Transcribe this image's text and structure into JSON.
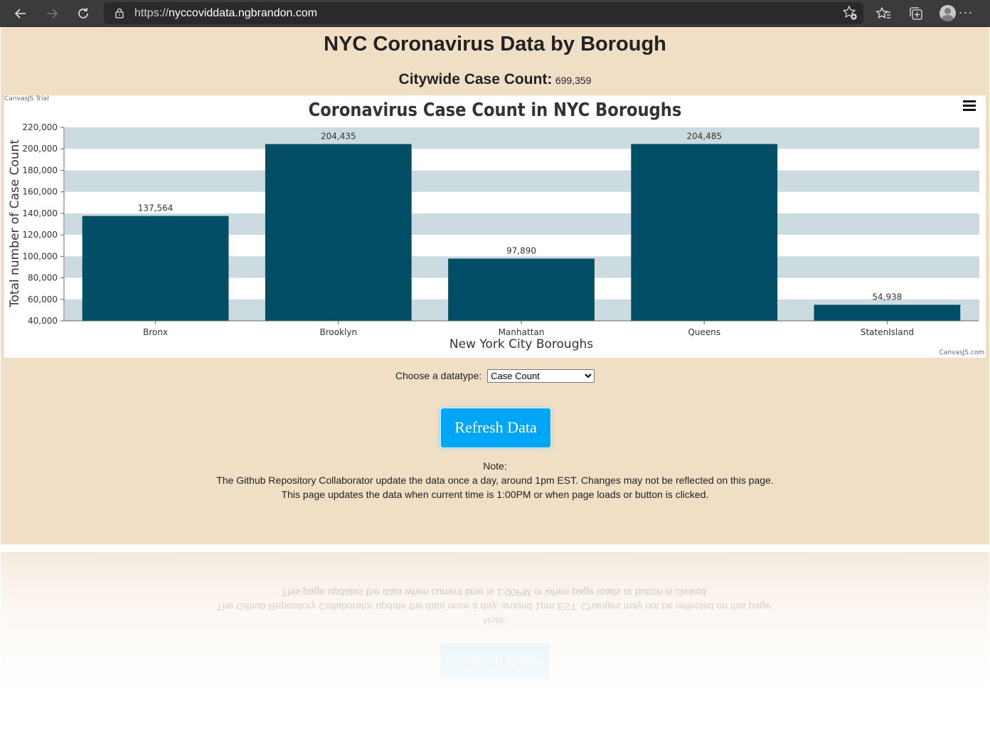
{
  "browser": {
    "url_scheme": "https://",
    "url_host": "nyccoviddata.ngbrandon.com",
    "more_label": "···"
  },
  "page": {
    "title": "NYC Coronavirus Data by Borough",
    "citywide_label": "Citywide Case Count:",
    "citywide_value": "699,359",
    "datatype_label": "Choose a datatype:",
    "datatype_selected": "Case Count",
    "refresh_label": "Refresh Data",
    "note_heading": "Note:",
    "note_line1": "The Github Repository Collaborator update the data once a day, around 1pm EST. Changes may not be reflected on this page.",
    "note_line2": "This page updates the data when current time is 1:00PM or when page loads or button is clicked."
  },
  "chart_meta": {
    "trial_label": "CanvasJS Trial",
    "credit_label": "CanvasJS.com",
    "bar_color": "#014e66",
    "stripe_color": "#ccdbe0",
    "page_bg": "#f0dec5",
    "button_color": "#00a6f6"
  },
  "chart_data": {
    "type": "bar",
    "title": "Coronavirus Case Count in NYC Boroughs",
    "xlabel": "New York City Boroughs",
    "ylabel": "Total number of Case Count",
    "categories": [
      "Bronx",
      "Brooklyn",
      "Manhattan",
      "Queens",
      "StatenIsland"
    ],
    "values": [
      137564,
      204435,
      97890,
      204485,
      54938
    ],
    "data_labels": [
      "137,564",
      "204,435",
      "97,890",
      "204,485",
      "54,938"
    ],
    "ylim": [
      40000,
      220000
    ],
    "yticks": [
      40000,
      60000,
      80000,
      100000,
      120000,
      140000,
      160000,
      180000,
      200000,
      220000
    ],
    "ytick_labels": [
      "40,000",
      "60,000",
      "80,000",
      "100,000",
      "120,000",
      "140,000",
      "160,000",
      "180,000",
      "200,000",
      "220,000"
    ],
    "grid": "alternating stripes",
    "legend": "none"
  }
}
